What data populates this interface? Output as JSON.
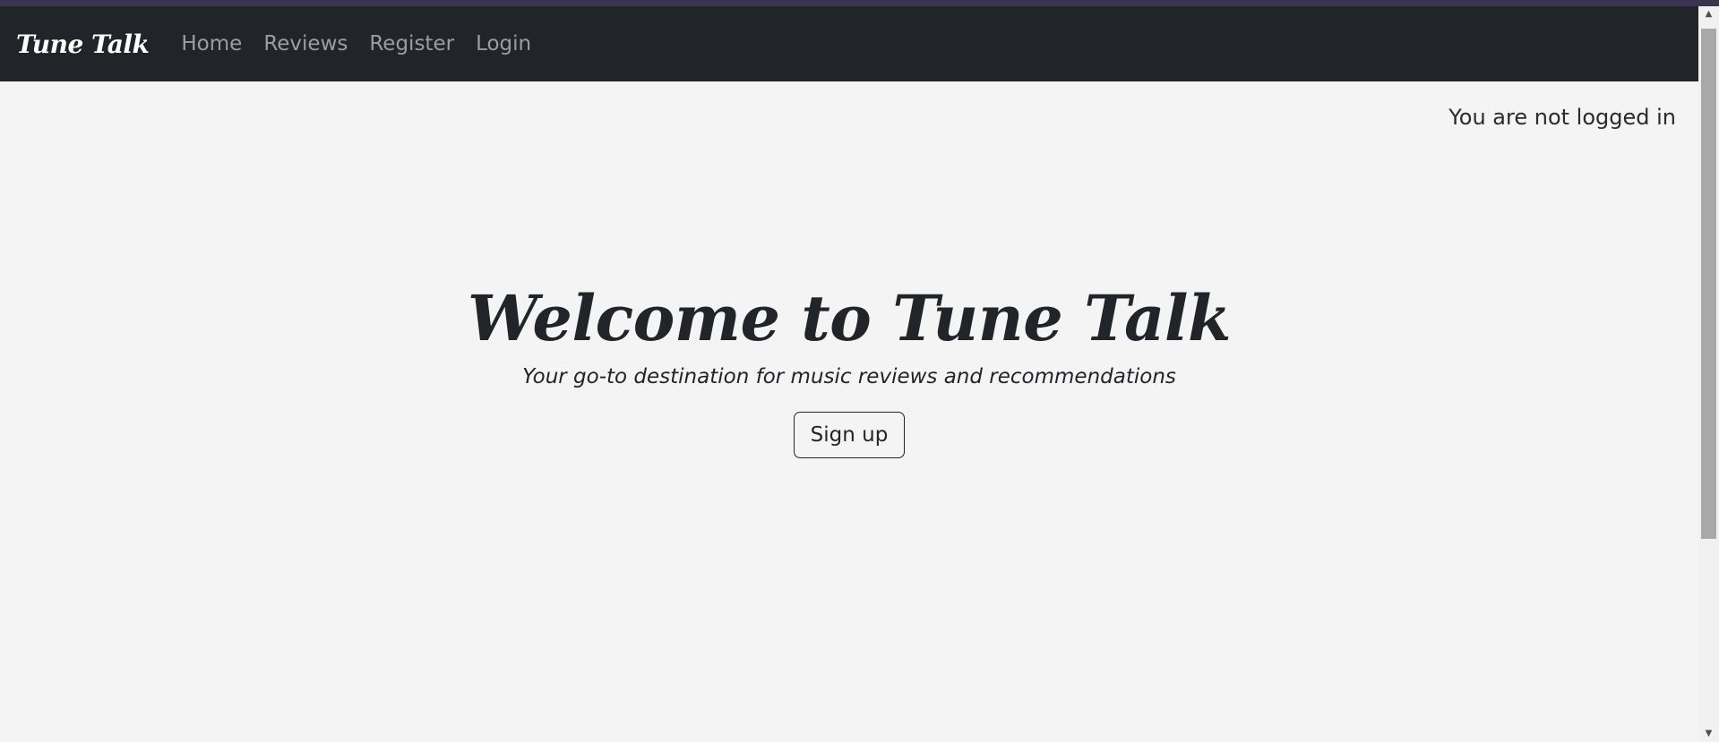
{
  "navbar": {
    "brand": "Tune Talk",
    "links": [
      "Home",
      "Reviews",
      "Register",
      "Login"
    ]
  },
  "status": "You are not logged in",
  "hero": {
    "title": "Welcome to Tune Talk",
    "subtitle": "Your go-to destination for music reviews and recommendations",
    "button_label": "Sign up"
  },
  "scrollbar": {
    "up_icon": "arrow-up-icon",
    "down_icon": "arrow-down-icon"
  },
  "colors": {
    "navbar_bg": "#212529",
    "page_bg": "#f4f4f4",
    "text": "#212529"
  }
}
